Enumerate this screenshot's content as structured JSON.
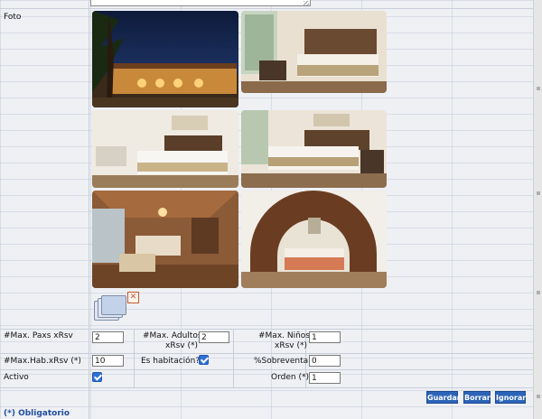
{
  "form": {
    "foto_label": "Foto",
    "max_paxs_label": "#Max. Paxs xRsv",
    "max_paxs_value": "2",
    "max_adultos_label_1": "#Max. Adultos",
    "max_adultos_label_2": "xRsv (*)",
    "max_adultos_value": "2",
    "max_ninos_label_1": "#Max. Niños",
    "max_ninos_label_2": "xRsv (*)",
    "max_ninos_value": "1",
    "max_hab_label": "#Max.Hab.xRsv (*)",
    "max_hab_value": "10",
    "es_habitacion_label": "Es habitación?",
    "es_habitacion_checked": true,
    "sobreventa_label": "%Sobreventa",
    "sobreventa_value": "0",
    "activo_label": "Activo",
    "activo_checked": true,
    "orden_label": "Orden (*)",
    "orden_value": "1"
  },
  "photos": [
    {
      "icon": "hotel-exterior-night-photo"
    },
    {
      "icon": "bedroom-window-photo"
    },
    {
      "icon": "bedroom-artwork-photo"
    },
    {
      "icon": "bedroom-sofa-photo"
    },
    {
      "icon": "wooden-cabin-bedroom-photo"
    },
    {
      "icon": "arched-wood-bedroom-photo"
    }
  ],
  "actions": {
    "guardar": "Guardar",
    "borrar": "Borrar",
    "ignorar": "Ignorar"
  },
  "footnote": "(*) Obligatorio",
  "colors": {
    "button_blue": "#2c64b8",
    "checkbox_blue": "#2f6fd6",
    "footnote_blue": "#1f4fa0",
    "delete_orange": "#c45a2a"
  }
}
